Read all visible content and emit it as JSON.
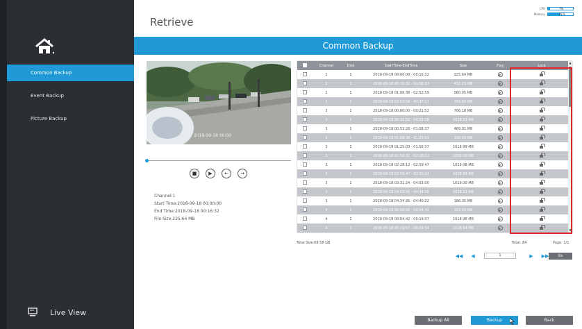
{
  "header": {
    "title": "Retrieve"
  },
  "stats": {
    "cpu_label": "CPU",
    "cpu_value": "7%",
    "cpu_fraction": 0.07,
    "memory_label": "Memory",
    "memory_value": "51%",
    "memory_fraction": 0.51
  },
  "banner": {
    "title": "Common Backup"
  },
  "sidebar": {
    "items": [
      {
        "label": "Common Backup",
        "active": true
      },
      {
        "label": "Event Backup",
        "active": false
      },
      {
        "label": "Picture Backup",
        "active": false
      }
    ],
    "live_view": "Live View"
  },
  "preview": {
    "timestamp": "2018-09-18 00:00"
  },
  "info": {
    "channel": "Channel:1",
    "start_time": "Start Time:2018-09-18 00:00:00",
    "end_time": "End Time:2018-09-18 00:16:32",
    "file_size": "File Size:225.64 MB"
  },
  "table": {
    "headers": [
      "Channel",
      "Disk",
      "StartTime-EndTime",
      "Size",
      "Play",
      "Lock"
    ],
    "rows": [
      {
        "channel": "1",
        "disk": "1",
        "time": "2018-09-18 00:00:00 - 00:16:32",
        "size": "225.64 MB"
      },
      {
        "channel": "1",
        "disk": "1",
        "time": "2018-09-18 00:16:32 - 01:08:37",
        "size": "437.23 MB"
      },
      {
        "channel": "1",
        "disk": "1",
        "time": "2018-09-18 01:08:38 - 02:52:59",
        "size": "580.05 MB"
      },
      {
        "channel": "1",
        "disk": "1",
        "time": "2018-09-18 02:52:59 - 04:37:11",
        "size": "250.60 MB"
      },
      {
        "channel": "3",
        "disk": "1",
        "time": "2018-09-18 00:00:00 - 00:21:52",
        "size": "706.18 MB"
      },
      {
        "channel": "3",
        "disk": "1",
        "time": "2018-09-18 00:21:52 - 00:53:28",
        "size": "1019.13 MB"
      },
      {
        "channel": "3",
        "disk": "1",
        "time": "2018-09-18 00:53:28 - 01:08:37",
        "size": "489.01 MB"
      },
      {
        "channel": "3",
        "disk": "1",
        "time": "2018-09-18 01:08:38 - 01:25:03",
        "size": "330.09 MB"
      },
      {
        "channel": "3",
        "disk": "1",
        "time": "2018-09-18 01:25:03 - 01:56:37",
        "size": "1018.99 MB"
      },
      {
        "channel": "3",
        "disk": "1",
        "time": "2018-09-18 01:56:37 - 02:28:12",
        "size": "1019.00 MB"
      },
      {
        "channel": "3",
        "disk": "1",
        "time": "2018-09-18 02:28:12 - 02:59:47",
        "size": "1019.08 MB"
      },
      {
        "channel": "3",
        "disk": "1",
        "time": "2018-09-18 02:59:47 - 03:31:24",
        "size": "1018.99 MB"
      },
      {
        "channel": "3",
        "disk": "1",
        "time": "2018-09-18 03:31:24 - 04:03:00",
        "size": "1019.00 MB"
      },
      {
        "channel": "3",
        "disk": "1",
        "time": "2018-09-18 04:03:00 - 04:34:35",
        "size": "1019.12 MB"
      },
      {
        "channel": "3",
        "disk": "1",
        "time": "2018-09-18 04:34:35 - 04:40:22",
        "size": "186.35 MB"
      },
      {
        "channel": "4",
        "disk": "1",
        "time": "2018-09-18 00:00:00 - 00:04:42",
        "size": "315.56 MB"
      },
      {
        "channel": "4",
        "disk": "1",
        "time": "2018-09-18 00:04:42 - 00:19:07",
        "size": "1018.98 MB"
      },
      {
        "channel": "4",
        "disk": "1",
        "time": "2018-09-18 00:19:07 - 00:34:14",
        "size": "1018.94 MB"
      }
    ]
  },
  "footer": {
    "total_size": "Total Size:69.58 GB",
    "total": "Total: 84",
    "page": "Page: 1/1",
    "page_input": "1",
    "go": "Go"
  },
  "buttons": {
    "backup_all": "Backup All",
    "backup": "Backup",
    "back": "Back"
  },
  "colors": {
    "accent": "#1f9ad6",
    "sidebar": "#2b2e33",
    "highlight": "#e0282c"
  },
  "icons": {
    "home": "home-icon",
    "live_view": "monitor-icon",
    "play": "play-circle-icon",
    "lock": "lock-icon"
  }
}
